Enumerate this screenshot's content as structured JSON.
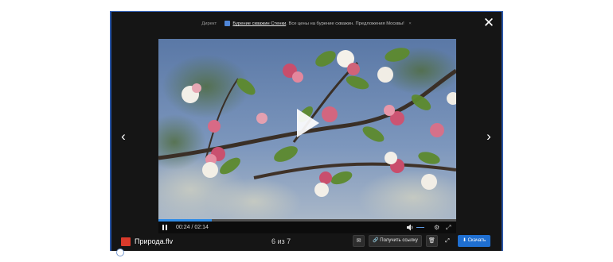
{
  "ad": {
    "label": "Директ",
    "link_text": "Бурение скважин Стенки",
    "text": "Все цены на бурение скважин. Предложения Москвы!",
    "close_glyph": "×",
    "icon": "ad-logo-icon"
  },
  "viewer": {
    "close_glyph": "✕",
    "prev_glyph": "‹",
    "next_glyph": "›"
  },
  "player": {
    "time": "00:24 / 02:14",
    "progress": 0.18,
    "volume": 0.2,
    "settings_glyph": "⚙",
    "fullscreen_glyph": "⤢",
    "accent_color": "#2f8be6"
  },
  "file": {
    "name": "Природа.flv",
    "counter": "6 из 7"
  },
  "actions": {
    "mail_glyph": "✉",
    "link_label": "🔗 Получить ссылку",
    "trash_glyph": "🗑",
    "expand_glyph": "⤢",
    "download_label": "⬇ Скачать",
    "download_color": "#1f6fd1"
  }
}
